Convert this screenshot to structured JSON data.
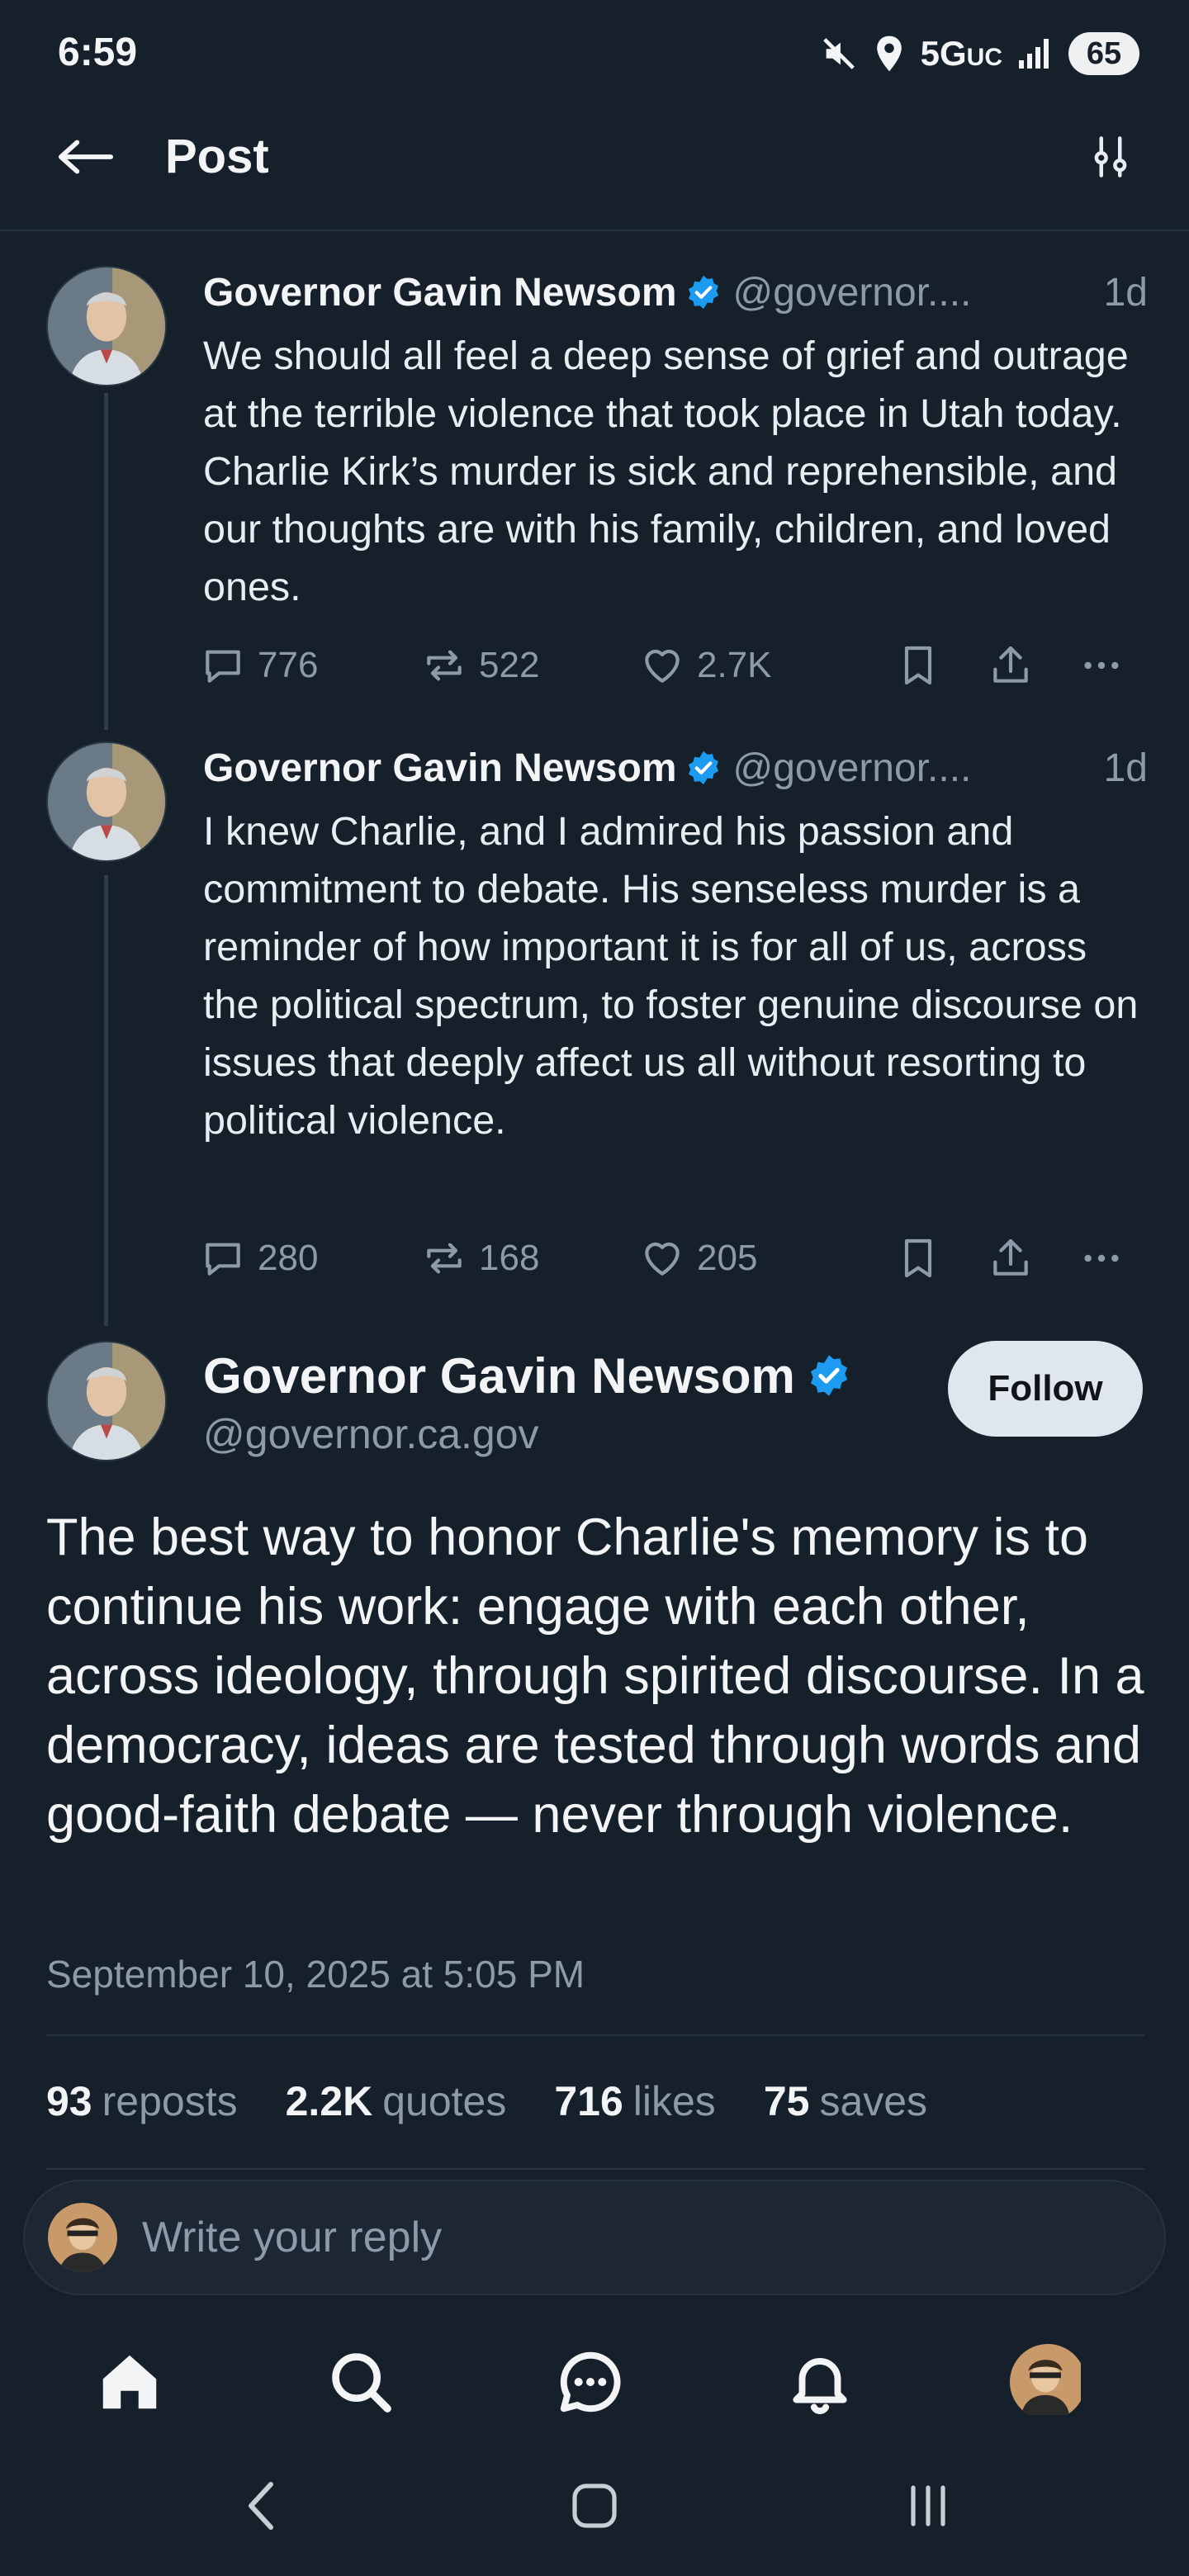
{
  "status_bar": {
    "time": "6:59",
    "network": "5G",
    "network_suffix": "UC",
    "battery": "65"
  },
  "header": {
    "title": "Post"
  },
  "thread": [
    {
      "author": "Governor Gavin Newsom",
      "handle": "@governor....",
      "time": "1d",
      "text": "We should all feel a deep sense of grief and outrage at the terrible violence that took place in Utah today. Charlie Kirk’s murder is sick and reprehensible, and our thoughts are with his family, children, and loved ones.",
      "replies": "776",
      "reposts": "522",
      "likes": "2.7K"
    },
    {
      "author": "Governor Gavin Newsom",
      "handle": "@governor....",
      "time": "1d",
      "text": "I knew Charlie, and I admired his passion and commitment to debate. His senseless murder is a reminder of how important it is for all of us, across the political spectrum, to foster genuine discourse on issues that deeply affect us all without resorting to political violence.",
      "replies": "280",
      "reposts": "168",
      "likes": "205"
    }
  ],
  "main_post": {
    "author": "Governor Gavin Newsom",
    "handle": "@governor.ca.gov",
    "follow_label": "Follow",
    "text": "The best way to honor Charlie's memory is to continue his work: engage with each other, across ideology, through spirited discourse. In a democracy, ideas are tested through words and good-faith debate — never through violence.",
    "date": "September 10, 2025 at 5:05 PM",
    "stats": {
      "reposts_count": "93",
      "reposts_label": "reposts",
      "quotes_count": "2.2K",
      "quotes_label": "quotes",
      "likes_count": "716",
      "likes_label": "likes",
      "saves_count": "75",
      "saves_label": "saves"
    }
  },
  "reply": {
    "placeholder": "Write your reply"
  },
  "colors": {
    "background": "#16202b",
    "verified": "#1d9bf0",
    "muted": "#8d9aa7"
  }
}
